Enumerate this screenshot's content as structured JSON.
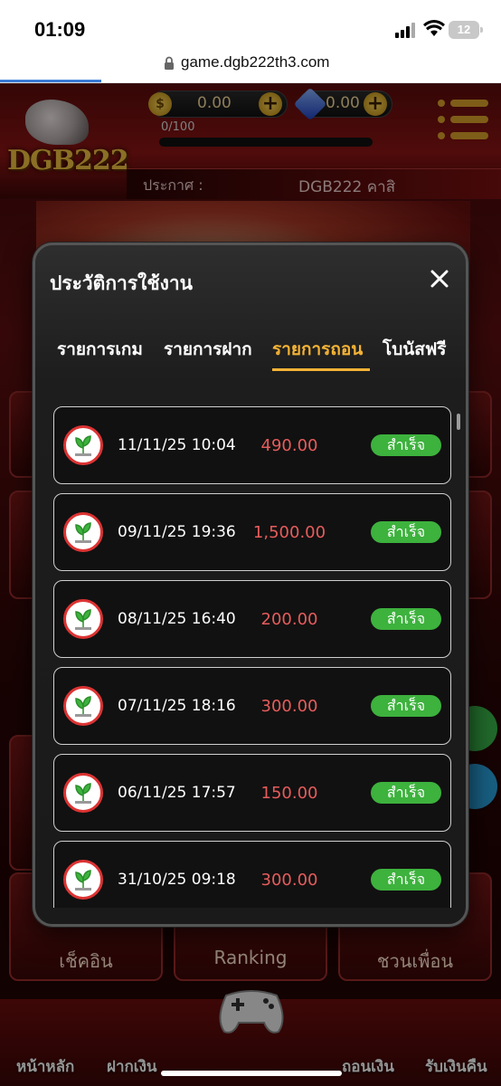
{
  "status_bar": {
    "time": "01:09",
    "battery": "12"
  },
  "browser": {
    "url": "game.dgb222th3.com"
  },
  "header": {
    "logo": "DGB222",
    "coin_balance": "0.00",
    "gem_balance": "0.00",
    "level_progress": "0/100",
    "announce_label": "ประกาศ :",
    "announce_text": "DGB222 คาสิ"
  },
  "background": {
    "tiles": [
      "เช็คอิน",
      "Ranking",
      "ชวนเพื่อน"
    ]
  },
  "bottom_nav": [
    "หน้าหลัก",
    "ฝากเงิน",
    "ถอนเงิน",
    "รับเงินคืน"
  ],
  "modal": {
    "title": "ประวัติการใช้งาน",
    "tabs": [
      {
        "label": "รายการเกม",
        "active": false
      },
      {
        "label": "รายการฝาก",
        "active": false
      },
      {
        "label": "รายการถอน",
        "active": true
      },
      {
        "label": "โบนัสฟรี",
        "active": false
      }
    ],
    "transactions": [
      {
        "date": "11/11/25 10:04",
        "amount": "490.00",
        "status": "สำเร็จ"
      },
      {
        "date": "09/11/25 19:36",
        "amount": "1,500.00",
        "status": "สำเร็จ"
      },
      {
        "date": "08/11/25 16:40",
        "amount": "200.00",
        "status": "สำเร็จ"
      },
      {
        "date": "07/11/25 18:16",
        "amount": "300.00",
        "status": "สำเร็จ"
      },
      {
        "date": "06/11/25 17:57",
        "amount": "150.00",
        "status": "สำเร็จ"
      },
      {
        "date": "31/10/25 09:18",
        "amount": "300.00",
        "status": "สำเร็จ"
      }
    ]
  },
  "colors": {
    "accent": "#f5b335",
    "amount": "#e65c5c",
    "success": "#3db23d",
    "bank": "#d33"
  }
}
